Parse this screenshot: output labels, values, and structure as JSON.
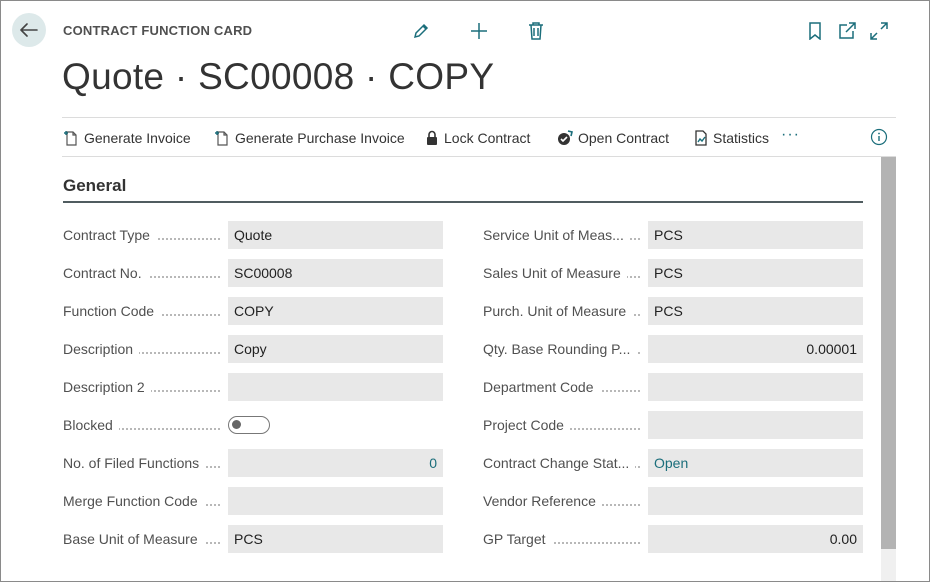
{
  "header": {
    "card_type": "CONTRACT FUNCTION CARD",
    "title": "Quote · SC00008 · COPY",
    "top_actions": [
      "edit-icon",
      "add-icon",
      "delete-icon",
      "bookmark-icon",
      "open-new-window-icon",
      "expand-icon"
    ]
  },
  "actions": [
    {
      "label": "Generate Invoice",
      "icon": "new-document-icon"
    },
    {
      "label": "Generate Purchase Invoice",
      "icon": "new-document-icon"
    },
    {
      "label": "Lock Contract",
      "icon": "lock-icon"
    },
    {
      "label": "Open Contract",
      "icon": "open-contract-icon"
    },
    {
      "label": "Statistics",
      "icon": "statistics-icon"
    }
  ],
  "more_label": "···",
  "section": {
    "title": "General"
  },
  "left_fields": [
    {
      "label": "Contract Type",
      "value": "Quote"
    },
    {
      "label": "Contract No.",
      "value": "SC00008"
    },
    {
      "label": "Function Code",
      "value": "COPY"
    },
    {
      "label": "Description",
      "value": "Copy"
    },
    {
      "label": "Description 2",
      "value": ""
    },
    {
      "label": "Blocked",
      "toggle": true,
      "toggle_on": false
    },
    {
      "label": "No. of Filed Functions",
      "value": "0",
      "align": "right",
      "link": true
    },
    {
      "label": "Merge Function Code",
      "value": ""
    },
    {
      "label": "Base Unit of Measure",
      "value": "PCS"
    }
  ],
  "right_fields": [
    {
      "label": "Service Unit of Meas...",
      "value": "PCS"
    },
    {
      "label": "Sales Unit of Measure",
      "value": "PCS"
    },
    {
      "label": "Purch. Unit of Measure",
      "value": "PCS"
    },
    {
      "label": "Qty. Base Rounding P...",
      "value": "0.00001",
      "align": "right"
    },
    {
      "label": "Department Code",
      "value": ""
    },
    {
      "label": "Project Code",
      "value": ""
    },
    {
      "label": "Contract Change Stat...",
      "value": "Open",
      "link": true
    },
    {
      "label": "Vendor Reference",
      "value": ""
    },
    {
      "label": "GP Target",
      "value": "0.00",
      "align": "right"
    }
  ],
  "colors": {
    "accent": "#1b6e7b",
    "field_bg": "#e8e8e8",
    "back_button_bg": "#dde9ea"
  }
}
